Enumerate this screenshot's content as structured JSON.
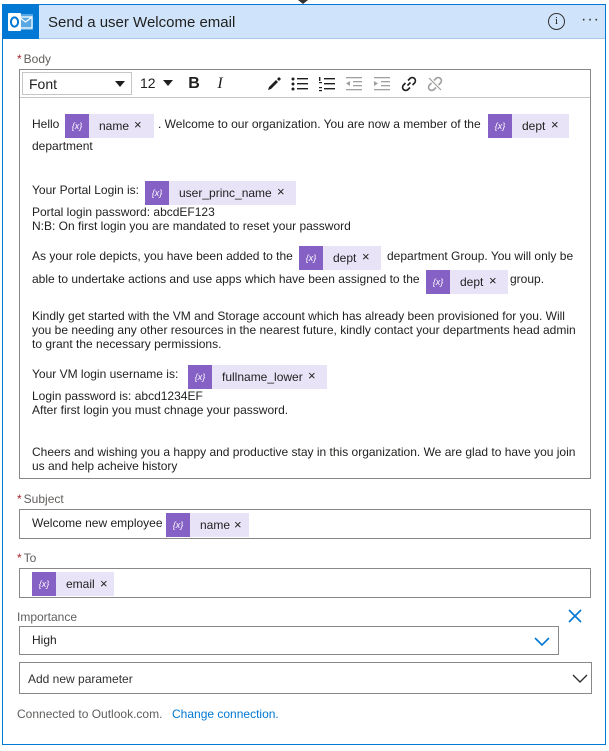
{
  "header": {
    "title": "Send a user Welcome email",
    "info_icon": "info-icon",
    "more_label": "···"
  },
  "body_field": {
    "label": "Body",
    "required_mark": "*",
    "toolbar": {
      "font": "Font",
      "size": "12",
      "buttons": [
        "bold-icon",
        "italic-icon",
        "color-picker-icon",
        "bulleted-list-icon",
        "numbered-list-icon",
        "decrease-indent-icon",
        "increase-indent-icon",
        "link-icon",
        "unlink-icon"
      ]
    },
    "text": {
      "hello": "Hello",
      "welcome": ". Welcome to our organization.  You are now a member of the",
      "department": "department",
      "portal_login": "Your Portal Login is:",
      "portal_password": "Portal login password: abcdEF123",
      "nb": "N:B: On first login you are mandated to reset your password",
      "role_a": "As your role depicts, you have been added to the",
      "role_b": "department Group. You will only be",
      "role_c": "able to undertake actions and use apps which have been assigned to the",
      "role_d": "group.",
      "kindly_1": "Kindly get started with the VM and Storage account which has already been provisioned for you. Will",
      "kindly_2": "you be needing any other resources in the nearest future, kindly contact your departments head admin",
      "kindly_3": "to grant the necessary permissions.",
      "vm_user": "Your VM login username is:",
      "vm_password": "Login password is: abcd1234EF",
      "after_login": "After first login you must chnage your password.",
      "cheers_1": "Cheers and wishing you a happy and productive stay in this organization. We are glad to have you join",
      "cheers_2": "us and help acheive history"
    },
    "tokens": {
      "name": "name",
      "dept": "dept",
      "user_princ_name": "user_princ_name",
      "fullname_lower": "fullname_lower",
      "close": "×",
      "icon": "{x}"
    }
  },
  "subject_field": {
    "label": "Subject",
    "required_mark": "*",
    "text": "Welcome new employee",
    "token": "name"
  },
  "to_field": {
    "label": "To",
    "required_mark": "*",
    "token": "email"
  },
  "importance_field": {
    "label": "Importance",
    "value": "High"
  },
  "add_parameter": {
    "label": "Add new parameter"
  },
  "footer": {
    "connected_text": "Connected to Outlook.com.",
    "change_link": "Change connection."
  },
  "colors": {
    "accent": "#0078d4",
    "header_bg": "#cfe4fa",
    "token_bg": "#e8e3f7",
    "token_icon": "#8661c5",
    "required": "#a4262c"
  }
}
